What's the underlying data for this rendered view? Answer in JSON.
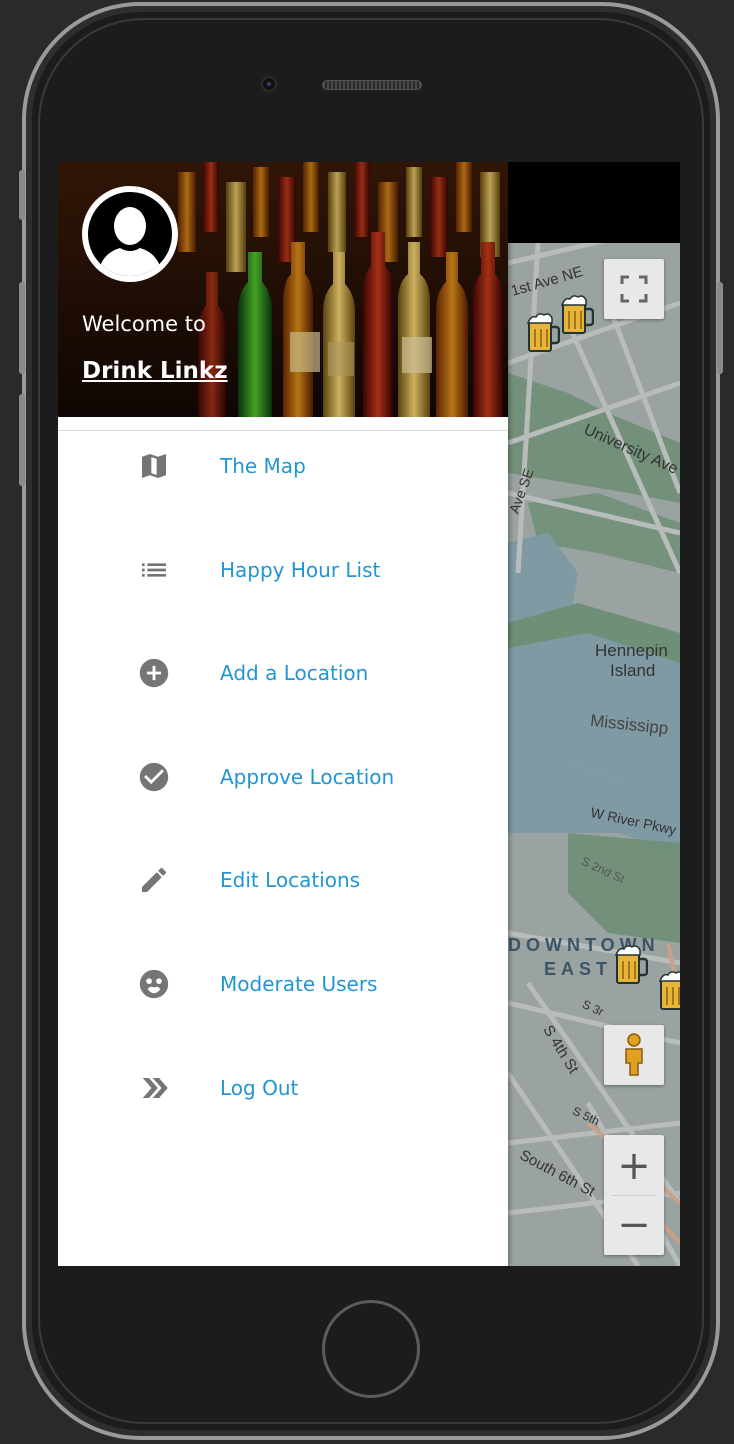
{
  "drawer": {
    "welcome_text": "Welcome to",
    "brand_name": "Drink Linkz",
    "menu": [
      {
        "label": "The Map",
        "icon": "map-icon"
      },
      {
        "label": "Happy Hour List",
        "icon": "list-icon"
      },
      {
        "label": "Add a Location",
        "icon": "add-circle-icon"
      },
      {
        "label": "Approve Location",
        "icon": "check-circle-icon"
      },
      {
        "label": "Edit Locations",
        "icon": "pencil-icon"
      },
      {
        "label": "Moderate Users",
        "icon": "face-icon"
      },
      {
        "label": "Log Out",
        "icon": "double-chevron-right-icon"
      }
    ]
  },
  "map": {
    "labels": {
      "first_ave": "1st Ave NE",
      "university_ave": "University Ave",
      "ave_se": "Ave SE",
      "hennepin_1": "Hennepin",
      "hennepin_2": "Island",
      "mississippi": "Mississipp",
      "w_river_pkwy": "W River Pkwy",
      "s_2nd_st": "S 2nd St",
      "downtown": "DOWNTOWN",
      "east": "EAST",
      "s_3rd": "S 3r",
      "s_4th_st": "S 4th St",
      "s_5th": "S 5th",
      "south_6th_st": "South 6th St"
    },
    "controls": {
      "zoom_in": "+",
      "zoom_out": "−"
    },
    "colors": {
      "water": "#7f9aa3",
      "park": "#6f8f76",
      "land": "#9aa3a1"
    }
  }
}
